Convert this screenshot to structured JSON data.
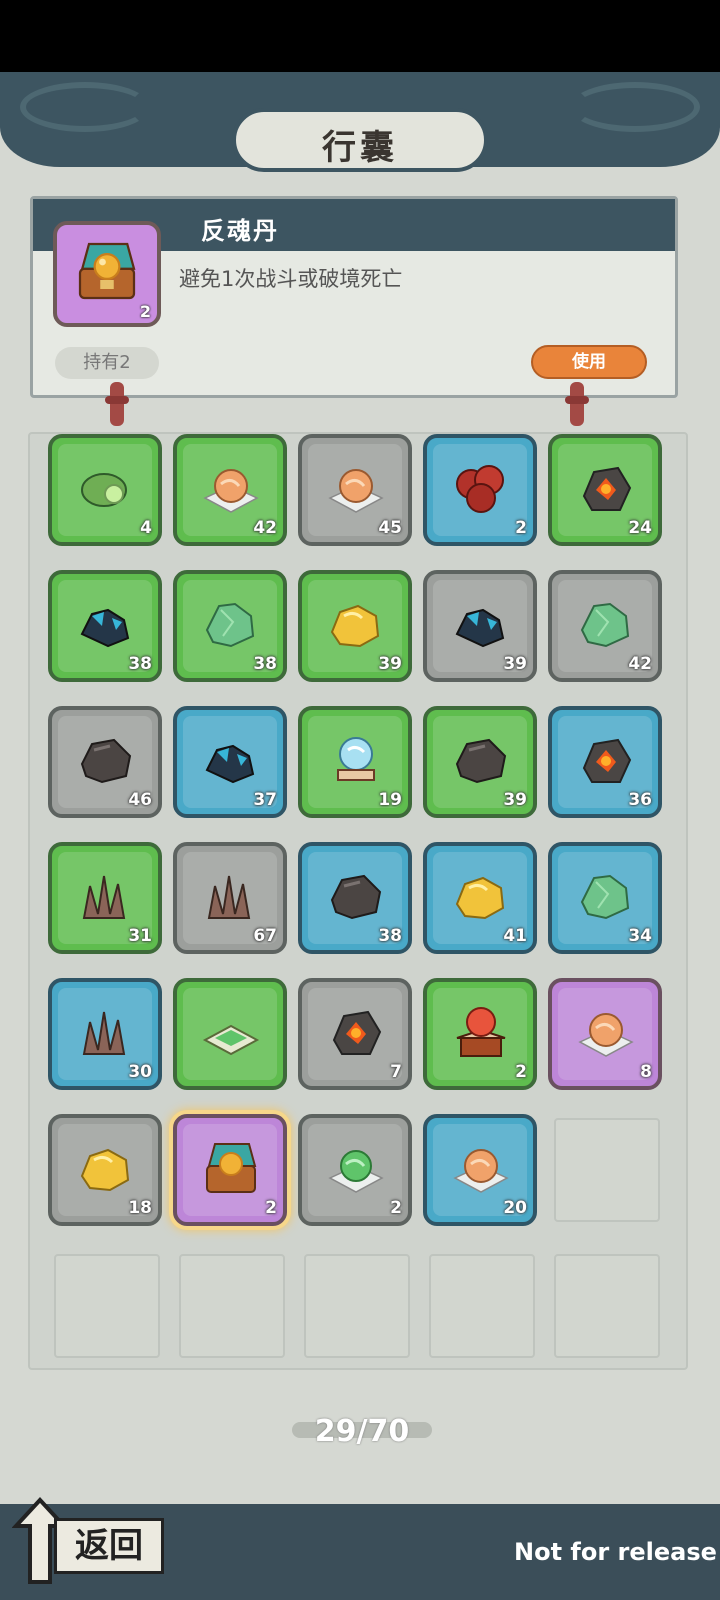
{
  "page": {
    "title": "行囊"
  },
  "detail": {
    "name": "反魂丹",
    "description": "避免1次战斗或破境死亡",
    "count": "2",
    "icon": "treasure-chest-orb",
    "owned_label": "持有2",
    "use_label": "使用"
  },
  "inventory": {
    "slots": [
      {
        "rarity": "green",
        "icon": "leaf-dew",
        "count": "4"
      },
      {
        "rarity": "green",
        "icon": "orange-pill",
        "count": "42"
      },
      {
        "rarity": "gray",
        "icon": "orange-pill",
        "count": "45"
      },
      {
        "rarity": "blue",
        "icon": "red-slices",
        "count": "2"
      },
      {
        "rarity": "green",
        "icon": "magma-rock",
        "count": "24"
      },
      {
        "rarity": "green",
        "icon": "blue-ore",
        "count": "38"
      },
      {
        "rarity": "green",
        "icon": "green-crystal",
        "count": "38"
      },
      {
        "rarity": "green",
        "icon": "gold-nugget",
        "count": "39"
      },
      {
        "rarity": "gray",
        "icon": "blue-ore",
        "count": "39"
      },
      {
        "rarity": "gray",
        "icon": "green-crystal",
        "count": "42"
      },
      {
        "rarity": "gray",
        "icon": "dark-stone",
        "count": "46"
      },
      {
        "rarity": "blue",
        "icon": "blue-ore",
        "count": "37"
      },
      {
        "rarity": "green",
        "icon": "crystal-ball",
        "count": "19"
      },
      {
        "rarity": "green",
        "icon": "dark-stone",
        "count": "39"
      },
      {
        "rarity": "blue",
        "icon": "magma-rock",
        "count": "36"
      },
      {
        "rarity": "green",
        "icon": "brown-crystal",
        "count": "31"
      },
      {
        "rarity": "gray",
        "icon": "brown-crystal",
        "count": "67"
      },
      {
        "rarity": "blue",
        "icon": "dark-stone",
        "count": "38"
      },
      {
        "rarity": "blue",
        "icon": "gold-nugget",
        "count": "41"
      },
      {
        "rarity": "blue",
        "icon": "green-crystal",
        "count": "34"
      },
      {
        "rarity": "blue",
        "icon": "brown-crystal",
        "count": "30"
      },
      {
        "rarity": "green",
        "icon": "green-powder",
        "count": ""
      },
      {
        "rarity": "gray",
        "icon": "magma-rock",
        "count": "7"
      },
      {
        "rarity": "green",
        "icon": "red-orb-box",
        "count": "2"
      },
      {
        "rarity": "purple",
        "icon": "orange-pill",
        "count": "8"
      },
      {
        "rarity": "gray",
        "icon": "gold-nugget",
        "count": "18"
      },
      {
        "rarity": "purple",
        "icon": "treasure-chest-orb",
        "count": "2",
        "selected": true
      },
      {
        "rarity": "gray",
        "icon": "green-pill",
        "count": "2"
      },
      {
        "rarity": "blue",
        "icon": "orange-pill",
        "count": "20"
      }
    ],
    "empty_slots": 6
  },
  "counter": "29/70",
  "footer": {
    "back_label": "返回",
    "watermark": "Not for release"
  }
}
